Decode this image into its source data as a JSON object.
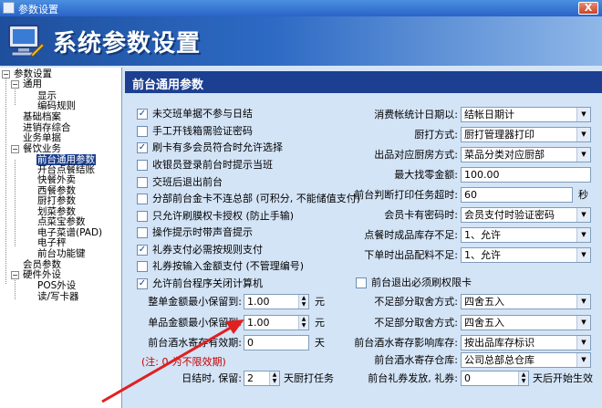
{
  "window": {
    "title": "参数设置",
    "close_glyph": "X"
  },
  "banner": {
    "title": "系统参数设置"
  },
  "tree": {
    "items": [
      {
        "label": "参数设置"
      },
      {
        "label": "通用"
      },
      {
        "label": "显示"
      },
      {
        "label": "编码规则"
      },
      {
        "label": "基础档案"
      },
      {
        "label": "进销存综合"
      },
      {
        "label": "业务单据"
      },
      {
        "label": "餐饮业务"
      },
      {
        "label": "前台通用参数"
      },
      {
        "label": "开台点餐结账"
      },
      {
        "label": "快餐外卖"
      },
      {
        "label": "西餐参数"
      },
      {
        "label": "厨打参数"
      },
      {
        "label": "划菜参数"
      },
      {
        "label": "点菜宝参数"
      },
      {
        "label": "电子菜谱(PAD)"
      },
      {
        "label": "电子秤"
      },
      {
        "label": "前台功能键"
      },
      {
        "label": "会员参数"
      },
      {
        "label": "硬件外设"
      },
      {
        "label": "POS外设"
      },
      {
        "label": "读/写卡器"
      }
    ]
  },
  "panel": {
    "header": "前台通用参数",
    "checkboxes": [
      {
        "label": "未交班单据不参与日结",
        "checked": true
      },
      {
        "label": "手工开钱箱需验证密码",
        "checked": false
      },
      {
        "label": "刷卡有多会员符合时允许选择",
        "checked": true
      },
      {
        "label": "收银员登录前台时提示当班",
        "checked": false
      },
      {
        "label": "交班后退出前台",
        "checked": false
      },
      {
        "label": "分部前台金卡不连总部 (可积分, 不能储值支付)",
        "checked": false
      },
      {
        "label": "只允许刷膜权卡授权 (防止手输)",
        "checked": false
      },
      {
        "label": "操作提示时带声音提示",
        "checked": false
      },
      {
        "label": "礼券支付必需按规则支付",
        "checked": true
      },
      {
        "label": "礼券按输入金额支付 (不管理编号)",
        "checked": false
      },
      {
        "label": "允许前台程序关闭计算机",
        "checked": true
      }
    ],
    "right_fields": [
      {
        "label": "消费帐统计日期以:",
        "value": "结帐日期计",
        "kind": "select"
      },
      {
        "label": "厨打方式:",
        "value": "厨打管理器打印",
        "kind": "select"
      },
      {
        "label": "出品对应厨房方式:",
        "value": "菜品分类对应厨部",
        "kind": "select"
      },
      {
        "label": "最大找零金额:",
        "value": "100.00",
        "kind": "input"
      },
      {
        "label": "前台判断打印任务超时:",
        "value": "60",
        "kind": "input",
        "suffix": "秒"
      },
      {
        "label": "会员卡有密码时:",
        "value": "会员支付时验证密码",
        "kind": "select"
      },
      {
        "label": "点餐时成品库存不足:",
        "value": "1、允许",
        "kind": "select"
      },
      {
        "label": "下单时出品配料不足:",
        "value": "1、允许",
        "kind": "select"
      }
    ],
    "exit_card_checkbox": {
      "label": "前台退出必须刷权限卡",
      "checked": false
    },
    "left_fields": [
      {
        "label": "整单金额最小保留到:",
        "value": "1.00",
        "unit": "元"
      },
      {
        "label": "单品金额最小保留到:",
        "value": "1.00",
        "unit": "元"
      },
      {
        "label": "前台酒水寄存有效期:",
        "value": "0",
        "unit": "天"
      }
    ],
    "note": "(注: 0-为不限效期)",
    "daily_close": {
      "label": "日结时, 保留:",
      "value": "2",
      "suffix": "天厨打任务"
    },
    "bottom_right_fields": [
      {
        "label": "不足部分取舍方式:",
        "value": "四舍五入"
      },
      {
        "label": "不足部分取舍方式:",
        "value": "四舍五入"
      },
      {
        "label": "前台酒水寄存影响库存:",
        "value": "按出品库存标识"
      },
      {
        "label": "前台酒水寄存仓库:",
        "value": "公司总部总仓库"
      }
    ],
    "gift_voucher": {
      "label": "前台礼券发放, 礼券:",
      "value": "0",
      "suffix": "天后开始生效"
    }
  },
  "colors": {
    "header_bg": "#1c3f91",
    "panel_bg": "#d4e4f7",
    "annotation_arrow": "#e02020"
  }
}
